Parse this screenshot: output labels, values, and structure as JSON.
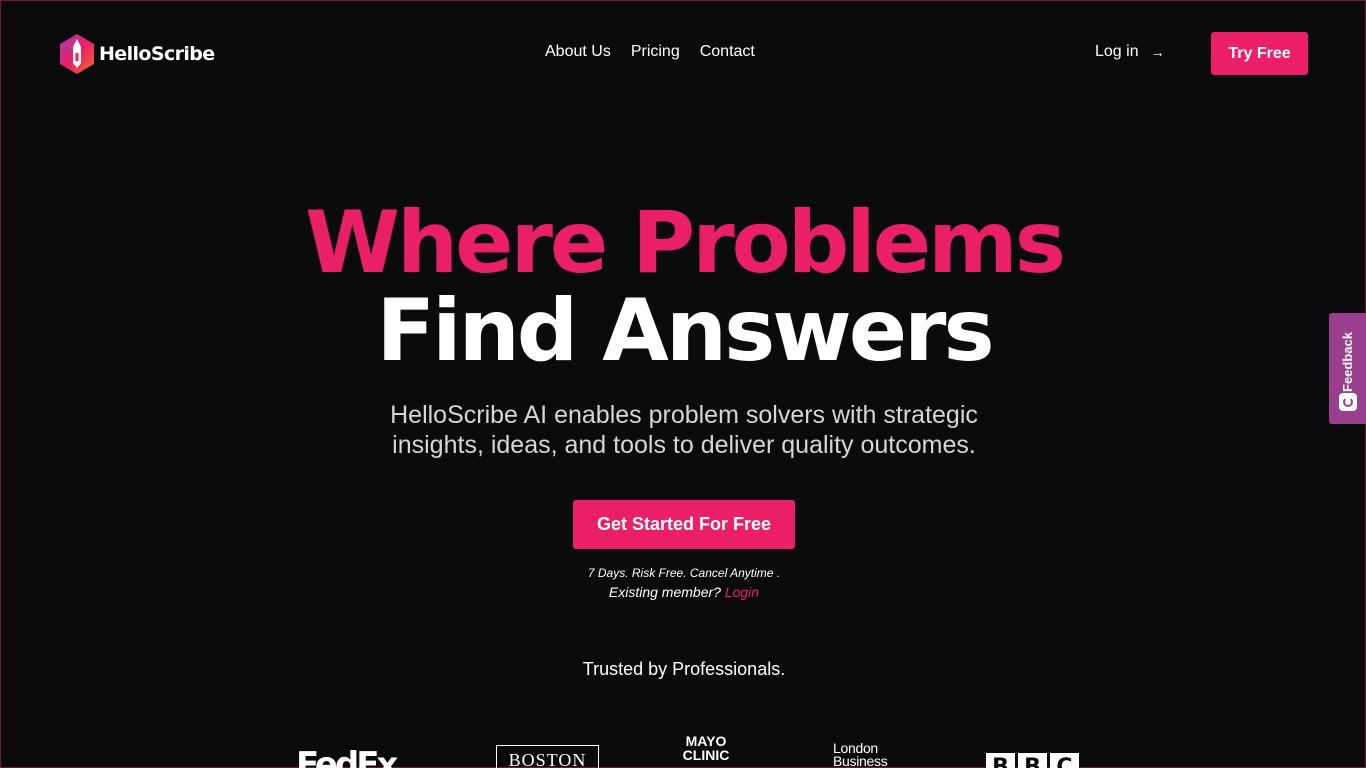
{
  "brand": {
    "name": "HelloScribe",
    "logo_icon": "hexagon-pen-icon",
    "colors": {
      "accent": "#ea1f68",
      "background": "#0b0b0d",
      "feedback": "#9a3e8e"
    }
  },
  "nav": {
    "items": [
      {
        "label": "About Us"
      },
      {
        "label": "Pricing"
      },
      {
        "label": "Contact"
      }
    ],
    "login_label": "Log in",
    "login_arrow": "→",
    "try_label": "Try Free"
  },
  "hero": {
    "line1": "Where Problems",
    "line2": "Find Answers",
    "subtitle_line1": "HelloScribe AI enables problem solvers with strategic",
    "subtitle_line2": "insights, ideas, and tools to deliver quality outcomes.",
    "cta_label": "Get Started For Free",
    "risk_text": "7 Days. Risk Free. Cancel Anytime .",
    "existing_text": "Existing member?",
    "existing_login": "Login"
  },
  "trusted": {
    "heading": "Trusted by Professionals.",
    "logos": {
      "fedex": "FedEx",
      "boston": "BOSTON",
      "mayo_line1": "MAYO",
      "mayo_line2": "CLINIC",
      "london_line1": "London",
      "london_line2": "Business",
      "bbc": [
        "B",
        "B",
        "C"
      ]
    }
  },
  "feedback": {
    "label": "Feedback",
    "icon": "feedback-smile-icon"
  }
}
